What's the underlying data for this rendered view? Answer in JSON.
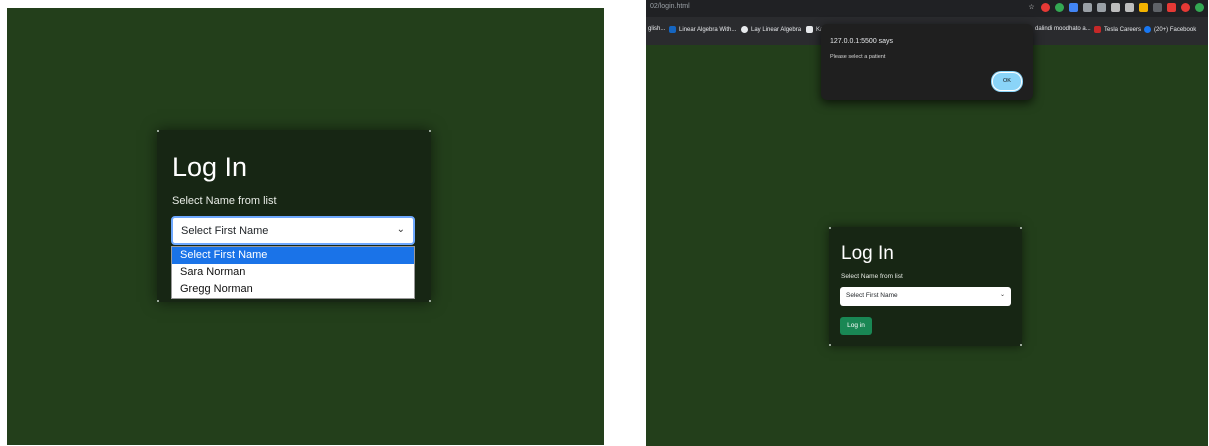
{
  "left": {
    "title": "Log In",
    "subtitle": "Select Name from list",
    "select_value": "Select First Name",
    "options": [
      "Select First Name",
      "Sara Norman",
      "Gregg Norman"
    ],
    "selected_index": 0,
    "chevron_icon": "chevron-down-icon"
  },
  "right": {
    "url": "02/login.html",
    "bookmarks": [
      "glish...",
      "Linear Algebra With...",
      "Lay Linear Algebra",
      "Ka",
      "dalindi moodhato a...",
      "Tesla Careers",
      "(20+) Facebook"
    ],
    "alert": {
      "title": "127.0.0.1:5500 says",
      "message": "Please select a patient",
      "ok_label": "OK"
    },
    "title": "Log In",
    "subtitle": "Select Name from list",
    "select_value": "Select First Name",
    "login_button": "Log in"
  },
  "colors": {
    "background": "#233f1b",
    "card": "#172614",
    "login_button": "#198754",
    "option_highlight": "#1a73e8",
    "ok_button": "#8ad4f8"
  }
}
